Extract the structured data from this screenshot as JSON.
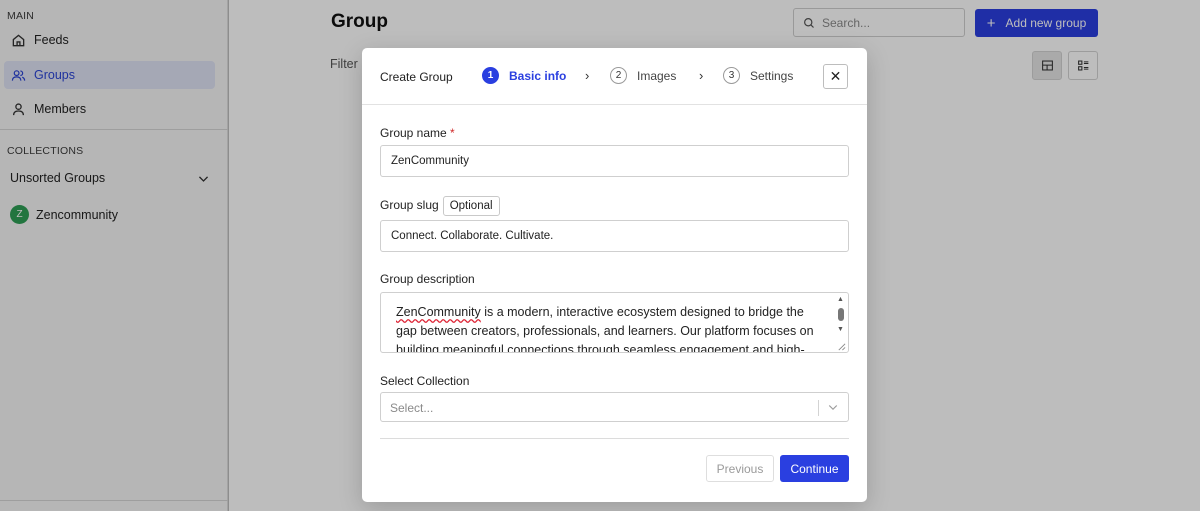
{
  "sidebar": {
    "main_section": "MAIN",
    "items": [
      {
        "label": "Feeds",
        "icon": "home-icon"
      },
      {
        "label": "Groups",
        "icon": "users-icon"
      },
      {
        "label": "Members",
        "icon": "user-icon"
      }
    ],
    "collections_section": "COLLECTIONS",
    "collection_dropdown": "Unsorted Groups",
    "collection_item": {
      "label": "Zencommunity",
      "avatar_letter": "Z"
    }
  },
  "header": {
    "title": "Group",
    "search_placeholder": "Search...",
    "add_label": "Add new group",
    "add_icon": "+"
  },
  "filter_label": "Filter",
  "modal": {
    "title": "Create Group",
    "steps": [
      {
        "num": "1",
        "label": "Basic info"
      },
      {
        "num": "2",
        "label": "Images"
      },
      {
        "num": "3",
        "label": "Settings"
      }
    ],
    "close": "✕",
    "fields": {
      "name_label": "Group name",
      "name_required": "*",
      "name_value": "ZenCommunity",
      "slug_label": "Group slug",
      "slug_badge": "Optional",
      "slug_value": "Connect. Collaborate. Cultivate.",
      "description_label": "Group description",
      "description_first_word": "ZenCommunity",
      "description_rest": " is a modern, interactive ecosystem designed to bridge the gap between creators, professionals, and learners. Our platform focuses on building meaningful connections through seamless engagement and high-",
      "collection_label": "Select Collection",
      "collection_placeholder": "Select..."
    },
    "previous_label": "Previous",
    "continue_label": "Continue"
  },
  "colors": {
    "accent": "#2a3fe0",
    "required": "#d02a2a",
    "avatar": "#2e9e56"
  }
}
